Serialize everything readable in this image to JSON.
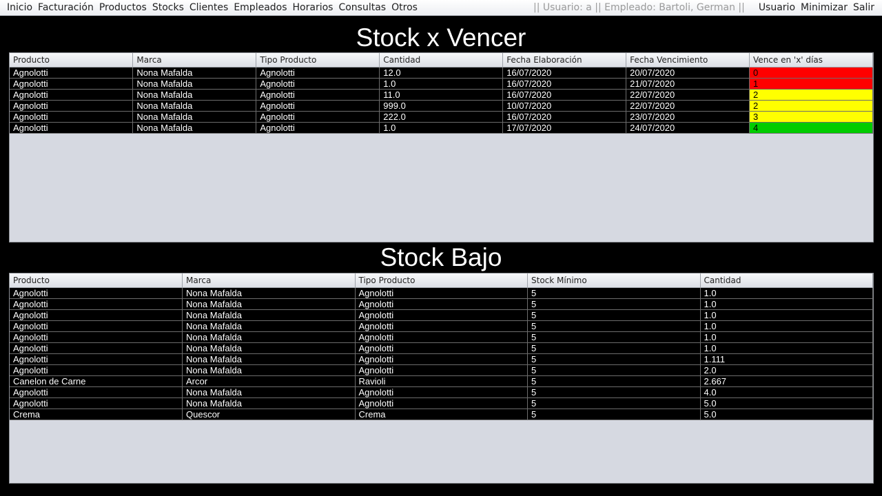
{
  "menu": [
    "Inicio",
    "Facturación",
    "Productos",
    "Stocks",
    "Clientes",
    "Empleados",
    "Horarios",
    "Consultas",
    "Otros"
  ],
  "status": "|| Usuario: a || Empleado: Bartoli, German ||",
  "right_menu": [
    "Usuario",
    "Minimizar",
    "Salir"
  ],
  "vencer": {
    "title": "Stock x Vencer",
    "columns": [
      "Producto",
      "Marca",
      "Tipo Producto",
      "Cantidad",
      "Fecha Elaboración",
      "Fecha Vencimiento",
      "Vence en 'x' días"
    ],
    "rows": [
      [
        "Agnolotti",
        "Nona Mafalda",
        "Agnolotti",
        "12.0",
        "16/07/2020",
        "20/07/2020",
        "0"
      ],
      [
        "Agnolotti",
        "Nona Mafalda",
        "Agnolotti",
        "1.0",
        "16/07/2020",
        "21/07/2020",
        "1"
      ],
      [
        "Agnolotti",
        "Nona Mafalda",
        "Agnolotti",
        "11.0",
        "16/07/2020",
        "22/07/2020",
        "2"
      ],
      [
        "Agnolotti",
        "Nona Mafalda",
        "Agnolotti",
        "999.0",
        "10/07/2020",
        "22/07/2020",
        "2"
      ],
      [
        "Agnolotti",
        "Nona Mafalda",
        "Agnolotti",
        "222.0",
        "16/07/2020",
        "23/07/2020",
        "3"
      ],
      [
        "Agnolotti",
        "Nona Mafalda",
        "Agnolotti",
        "1.0",
        "17/07/2020",
        "24/07/2020",
        "4"
      ]
    ],
    "day_colors": [
      "#ff0000",
      "#ff0000",
      "#ffff00",
      "#ffff00",
      "#ffff00",
      "#00cc00"
    ]
  },
  "bajo": {
    "title": "Stock Bajo",
    "columns": [
      "Producto",
      "Marca",
      "Tipo Producto",
      "Stock Mínimo",
      "Cantidad"
    ],
    "rows": [
      [
        "Agnolotti",
        "Nona Mafalda",
        "Agnolotti",
        "5",
        "1.0"
      ],
      [
        "Agnolotti",
        "Nona Mafalda",
        "Agnolotti",
        "5",
        "1.0"
      ],
      [
        "Agnolotti",
        "Nona Mafalda",
        "Agnolotti",
        "5",
        "1.0"
      ],
      [
        "Agnolotti",
        "Nona Mafalda",
        "Agnolotti",
        "5",
        "1.0"
      ],
      [
        "Agnolotti",
        "Nona Mafalda",
        "Agnolotti",
        "5",
        "1.0"
      ],
      [
        "Agnolotti",
        "Nona Mafalda",
        "Agnolotti",
        "5",
        "1.0"
      ],
      [
        "Agnolotti",
        "Nona Mafalda",
        "Agnolotti",
        "5",
        "1.111"
      ],
      [
        "Agnolotti",
        "Nona Mafalda",
        "Agnolotti",
        "5",
        "2.0"
      ],
      [
        "Canelon de Carne",
        "Arcor",
        "Ravioli",
        "5",
        "2.667"
      ],
      [
        "Agnolotti",
        "Nona Mafalda",
        "Agnolotti",
        "5",
        "4.0"
      ],
      [
        "Agnolotti",
        "Nona Mafalda",
        "Agnolotti",
        "5",
        "5.0"
      ],
      [
        "Crema",
        "Quescor",
        "Crema",
        "5",
        "5.0"
      ]
    ]
  }
}
